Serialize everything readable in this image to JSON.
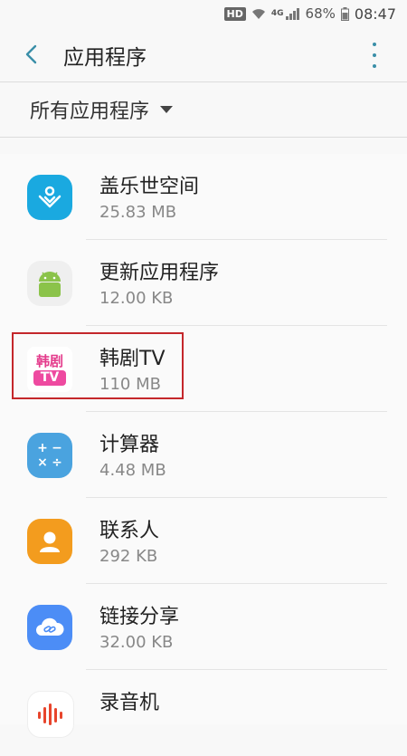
{
  "status_bar": {
    "hd": "HD",
    "network": "4G",
    "battery": "68%",
    "time": "08:47"
  },
  "app_bar": {
    "title": "应用程序",
    "back_icon": "back-arrow-icon",
    "more_icon": "more-vert-icon"
  },
  "filter": {
    "label": "所有应用程序"
  },
  "apps": [
    {
      "name": "盖乐世空间",
      "size": "25.83 MB",
      "icon": "galaxy-space-icon"
    },
    {
      "name": "更新应用程序",
      "size": "12.00 KB",
      "icon": "android-icon"
    },
    {
      "name": "韩剧TV",
      "size": "110 MB",
      "icon": "hanju-tv-icon",
      "icon_text_top": "韩剧",
      "icon_text_bottom": "TV"
    },
    {
      "name": "计算器",
      "size": "4.48 MB",
      "icon": "calculator-icon",
      "icon_glyphs": [
        "+",
        "−",
        "×",
        "÷"
      ]
    },
    {
      "name": "联系人",
      "size": "292 KB",
      "icon": "contacts-icon"
    },
    {
      "name": "链接分享",
      "size": "32.00 KB",
      "icon": "link-share-icon"
    },
    {
      "name": "录音机",
      "size": "",
      "icon": "voice-recorder-icon"
    }
  ],
  "colors": {
    "accent": "#3a8fa8",
    "highlight": "#c4272b",
    "galaxy_space": "#1aa9e0",
    "android": "#8bc34a",
    "calculator": "#4aa3df",
    "contacts": "#f39c1e",
    "link_share": "#4c8df6",
    "recorder": "#e8452c"
  }
}
